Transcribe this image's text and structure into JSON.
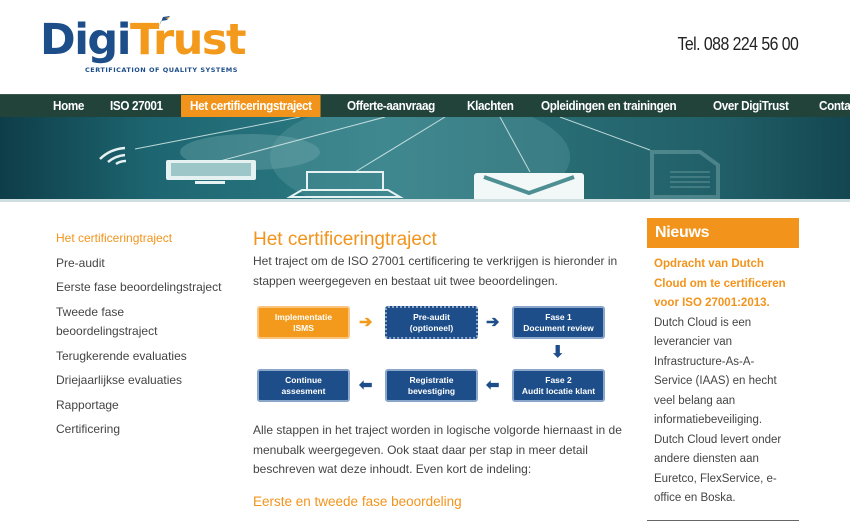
{
  "header": {
    "logo_part1": "Digi",
    "logo_part2": "Trust",
    "logo_tagline": "CERTIFICATION OF QUALITY SYSTEMS",
    "phone": "Tel. 088 224 56 00"
  },
  "nav": {
    "items": [
      {
        "label": "Home"
      },
      {
        "label": "ISO 27001"
      },
      {
        "label": "Het certificeringstraject",
        "active": true
      },
      {
        "label": "Offerte-aanvraag"
      },
      {
        "label": "Klachten"
      },
      {
        "label": "Opleidingen en trainingen"
      },
      {
        "label": "Over DigiTrust"
      },
      {
        "label": "Contact"
      }
    ]
  },
  "banner": {
    "icons": [
      "wifi-icon",
      "monitor-icon",
      "laptop-icon",
      "mail-icon",
      "document-icon"
    ]
  },
  "sidebar": {
    "items": [
      {
        "label": "Het certificeringtraject",
        "active": true
      },
      {
        "label": "Pre-audit"
      },
      {
        "label": "Eerste fase beoordelingstraject"
      },
      {
        "label": "Tweede fase beoordelingstraject"
      },
      {
        "label": "Terugkerende evaluaties"
      },
      {
        "label": "Driejaarlijkse evaluaties"
      },
      {
        "label": "Rapportage"
      },
      {
        "label": "Certificering"
      }
    ]
  },
  "main": {
    "title": "Het certificeringtraject",
    "intro": "Het traject om de ISO 27001 certificering te verkrijgen is hieronder in stappen weergegeven en bestaat uit twee beoordelingen.",
    "flow": {
      "step1": {
        "line1": "Implementatie",
        "line2": "ISMS"
      },
      "step2": {
        "line1": "Pre-audit",
        "line2": "(optioneel)"
      },
      "step3": {
        "line1": "Fase 1",
        "line2": "Document review"
      },
      "step4": {
        "line1": "Fase 2",
        "line2": "Audit locatie klant"
      },
      "step5": {
        "line1": "Registratie",
        "line2": "bevestiging"
      },
      "step6": {
        "line1": "Continue",
        "line2": "assesment"
      },
      "arrow_right": "➔",
      "arrow_down": "⬇",
      "arrow_left": "⬅"
    },
    "paragraph2": "Alle stappen in het traject worden in logische volgorde hiernaast in de menubalk weergegeven. Ook staat daar per stap in meer detail beschreven wat deze inhoudt. Even kort de indeling:",
    "subheading": "Eerste en tweede fase beoordeling"
  },
  "news": {
    "header": "Nieuws",
    "title": "Opdracht van Dutch Cloud om te certificeren voor ISO 27001:2013.",
    "text": "Dutch Cloud is een leverancier van Infrastructure-As-A-Service (IAAS) en hecht veel belang aan informatiebeveiliging. Dutch Cloud levert onder andere diensten aan Euretco, FlexService, e-office en Boska."
  },
  "colors": {
    "brand_orange": "#f2941c",
    "brand_blue": "#1d4e8a",
    "nav_bg": "#22433a"
  }
}
